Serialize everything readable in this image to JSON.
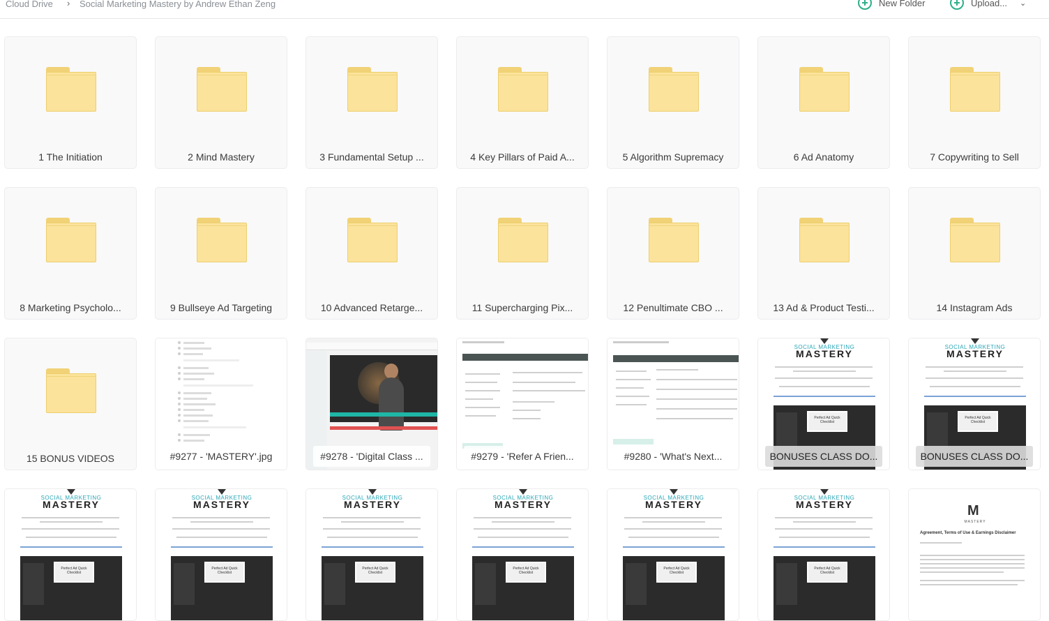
{
  "breadcrumb": {
    "root": "Cloud Drive",
    "current": "Social Marketing Mastery by Andrew Ethan Zeng"
  },
  "actions": {
    "new_folder": "New Folder",
    "upload": "Upload...",
    "accent_color": "#2eae89"
  },
  "items": [
    {
      "label": "1 The Initiation",
      "kind": "folder"
    },
    {
      "label": "2 Mind Mastery",
      "kind": "folder"
    },
    {
      "label": "3 Fundamental Setup ...",
      "kind": "folder"
    },
    {
      "label": "4 Key Pillars of Paid A...",
      "kind": "folder"
    },
    {
      "label": "5 Algorithm Supremacy",
      "kind": "folder"
    },
    {
      "label": "6 Ad Anatomy",
      "kind": "folder"
    },
    {
      "label": "7 Copywriting to Sell",
      "kind": "folder"
    },
    {
      "label": "8 Marketing Psycholo...",
      "kind": "folder"
    },
    {
      "label": "9 Bullseye Ad Targeting",
      "kind": "folder"
    },
    {
      "label": "10 Advanced Retarge...",
      "kind": "folder"
    },
    {
      "label": "11 Supercharging Pix...",
      "kind": "folder"
    },
    {
      "label": "12 Penultimate CBO ...",
      "kind": "folder"
    },
    {
      "label": "13 Ad & Product Testi...",
      "kind": "folder"
    },
    {
      "label": "14 Instagram Ads",
      "kind": "folder"
    },
    {
      "label": "15 BONUS VIDEOS",
      "kind": "folder"
    },
    {
      "label": "#9277 - 'MASTERY'.jpg",
      "kind": "doc-list"
    },
    {
      "label": "#9278 - 'Digital Class ...",
      "kind": "video"
    },
    {
      "label": "#9279 - 'Refer A Frien...",
      "kind": "app"
    },
    {
      "label": "#9280 - 'What's Next...",
      "kind": "app"
    },
    {
      "label": "BONUSES CLASS DO...",
      "kind": "mastery"
    },
    {
      "label": "BONUSES CLASS DO...",
      "kind": "mastery"
    }
  ],
  "partial_row": {
    "mastery_brand_top": "SOCIAL MARKETING",
    "mastery_brand": "MASTERY",
    "card_text": "Perfect Ad Quick Checklist",
    "agreement_title": "Agreement, Terms of Use & Earnings Disclaimer"
  }
}
